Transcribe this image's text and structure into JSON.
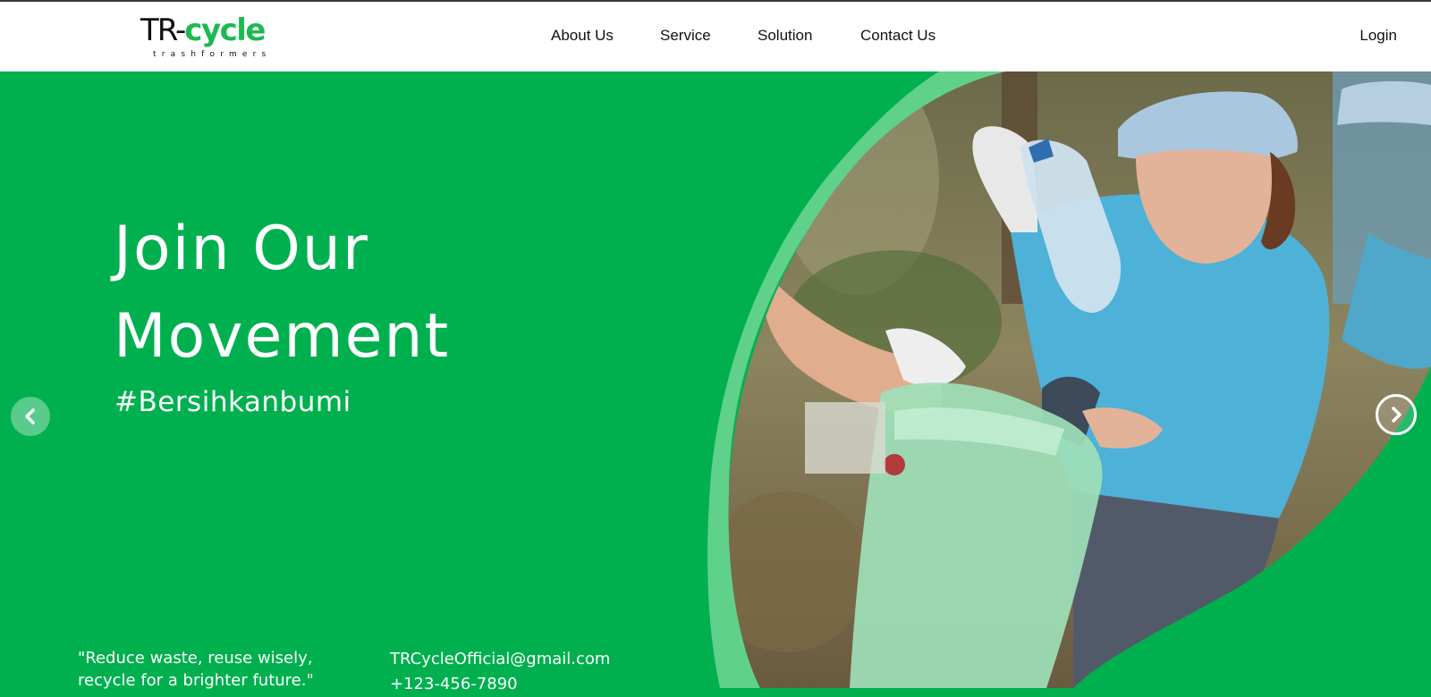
{
  "brand": {
    "logo_prefix": "TR-",
    "logo_accent": "cycle",
    "tagline": "trashformers",
    "primary_color": "#00b04f",
    "accent_color": "#1db954"
  },
  "nav": {
    "items": [
      {
        "label": "About Us"
      },
      {
        "label": "Service"
      },
      {
        "label": "Solution"
      },
      {
        "label": "Contact Us"
      }
    ],
    "login_label": "Login"
  },
  "hero": {
    "title_line1": "Join Our",
    "title_line2": "Movement",
    "hashtag": "#Bersihkanbumi",
    "image_description_icon": "volunteer-photo",
    "prev_icon": "chevron-left-icon",
    "next_icon": "chevron-right-icon"
  },
  "footer": {
    "quote": "\"Reduce waste, reuse wisely, recycle for a brighter future.\"",
    "email": "TRCycleOfficial@gmail.com",
    "phone": "+123-456-7890"
  }
}
